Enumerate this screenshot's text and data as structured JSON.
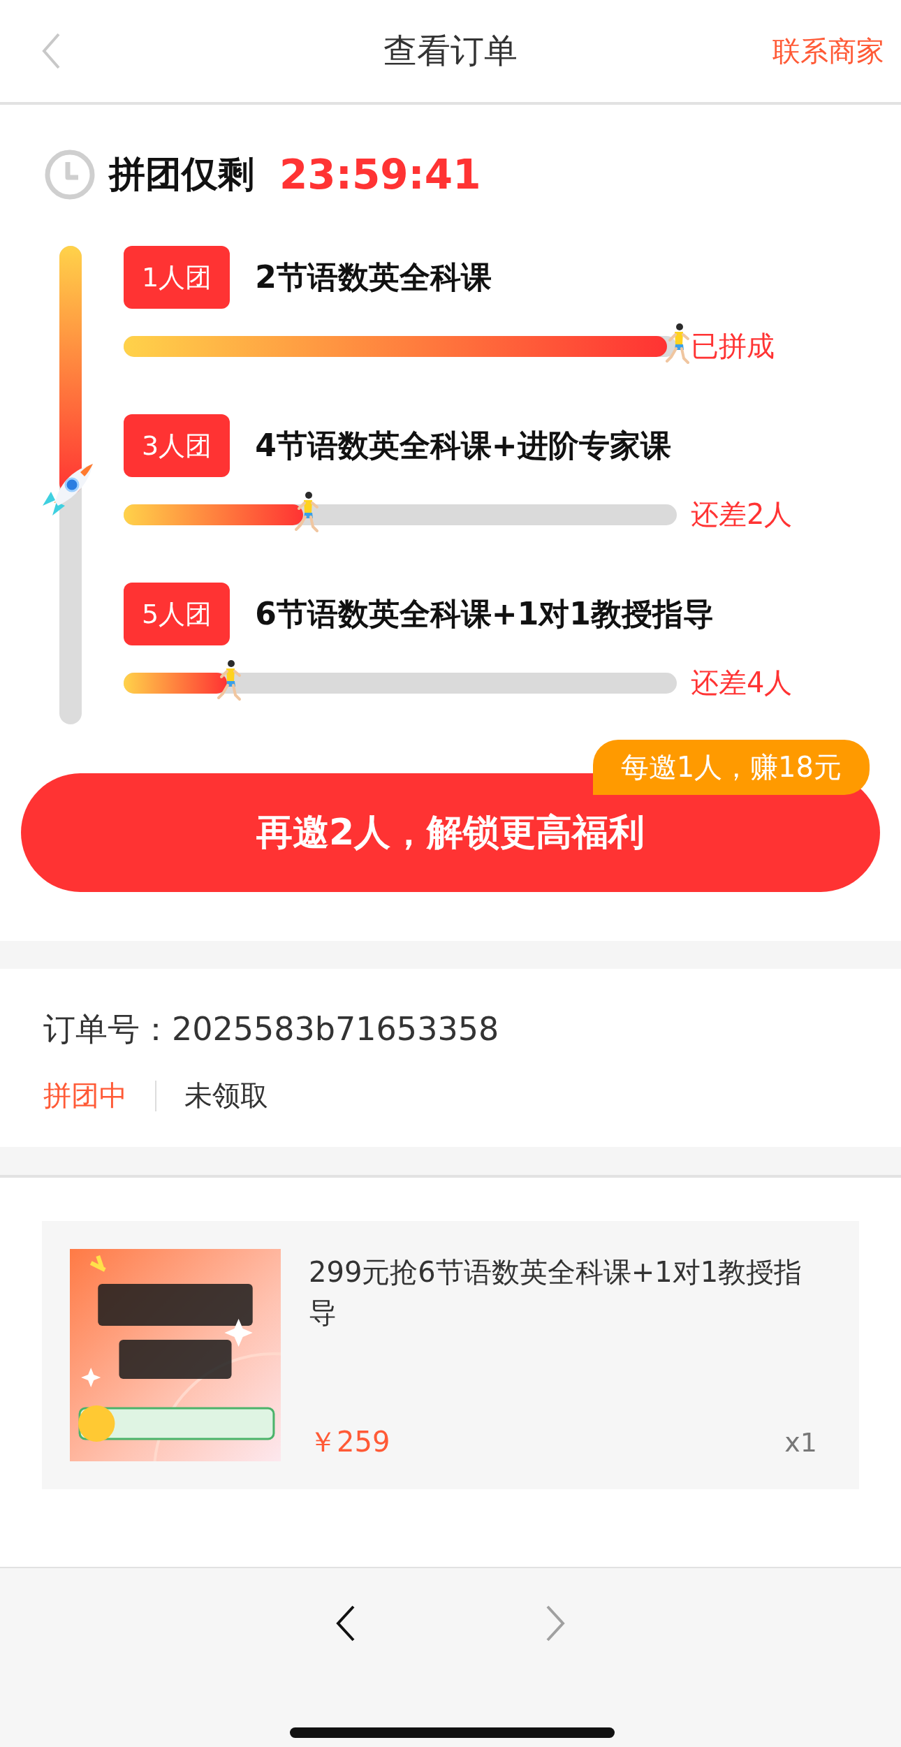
{
  "header": {
    "title": "查看订单",
    "action": "联系商家"
  },
  "countdown": {
    "label": "拼团仅剩",
    "time": "23:59:41"
  },
  "progress": {
    "level": 0.52,
    "tiers": [
      {
        "badge": "1人团",
        "title": "2节语数英全科课",
        "level": 1,
        "status": "已拼成"
      },
      {
        "badge": "3人团",
        "title": "4节语数英全科课+进阶专家课",
        "level": 0.33,
        "status": "还差2人"
      },
      {
        "badge": "5人团",
        "title": "6节语数英全科课+1对1教授指导",
        "level": 0.19,
        "status": "还差4人"
      }
    ]
  },
  "invite": {
    "tag": "每邀1人，赚18元",
    "button": "再邀2人，解锁更高福利"
  },
  "order": {
    "number_label": "订单号：",
    "number": "2025583b71653358",
    "status": "拼团中",
    "claim": "未领取"
  },
  "product": {
    "title": "299元抢6节语数英全科课+1对1教授指导",
    "price": "￥259",
    "quantity": "x1"
  },
  "bottom_nav": [
    {
      "kind": "back",
      "disabled": false
    },
    {
      "kind": "forward",
      "disabled": true
    }
  ]
}
